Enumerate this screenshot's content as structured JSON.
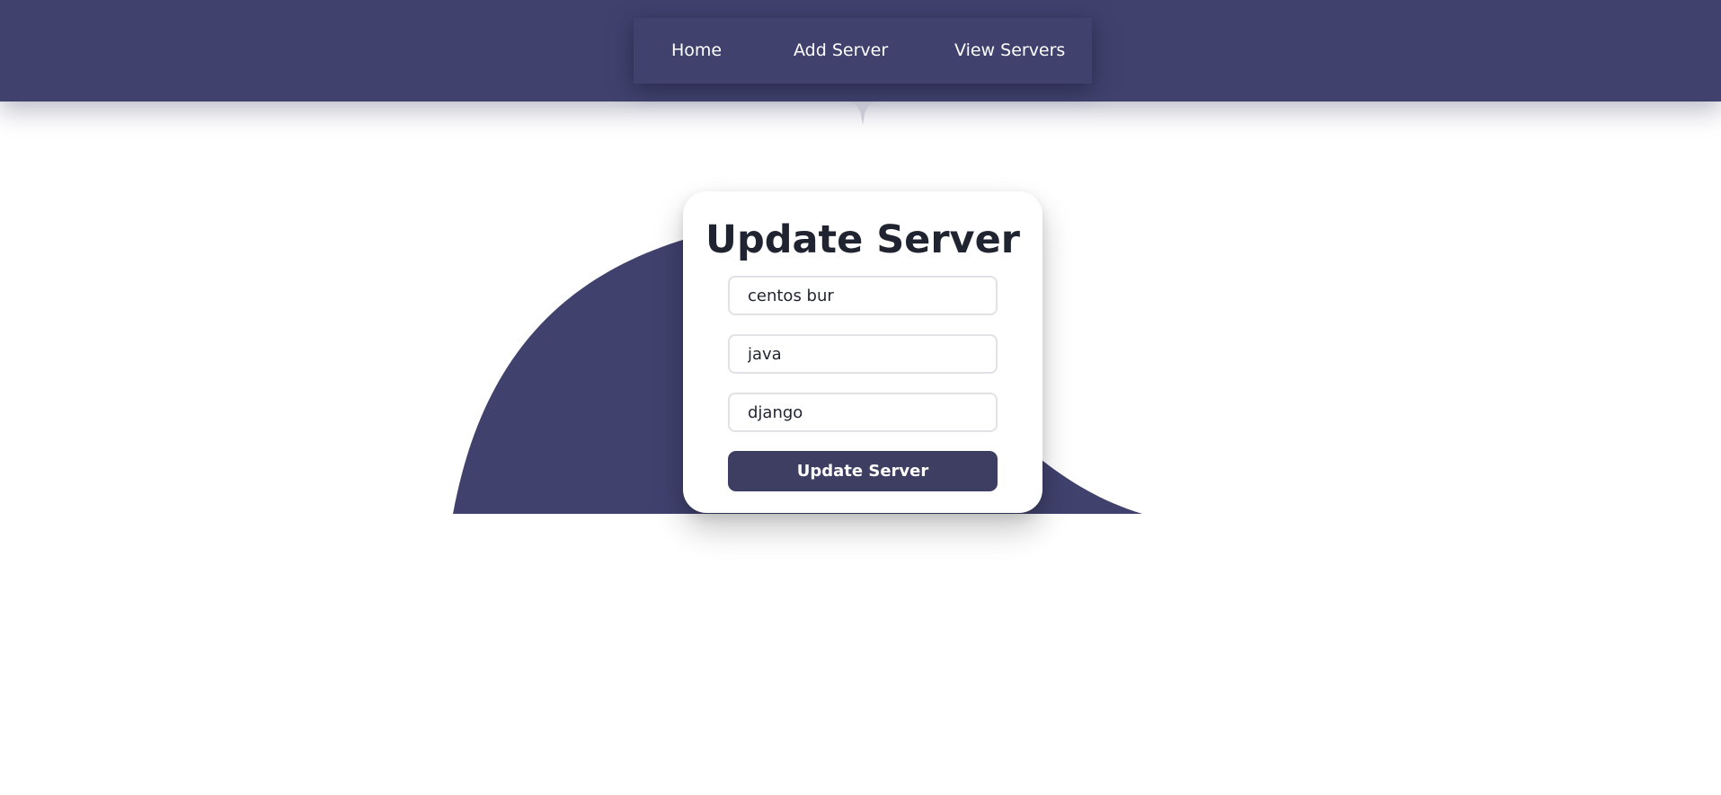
{
  "nav": {
    "items": [
      {
        "label": "Home"
      },
      {
        "label": "Add Server"
      },
      {
        "label": "View Servers"
      }
    ]
  },
  "form": {
    "title": "Update Server",
    "fields": [
      {
        "value": "centos bur"
      },
      {
        "value": "java"
      },
      {
        "value": "django"
      }
    ],
    "submit_label": "Update Server"
  },
  "colors": {
    "brand": "#40416d",
    "button": "#3d3e62",
    "title_text": "#1f2430",
    "background": "#ffffff"
  }
}
